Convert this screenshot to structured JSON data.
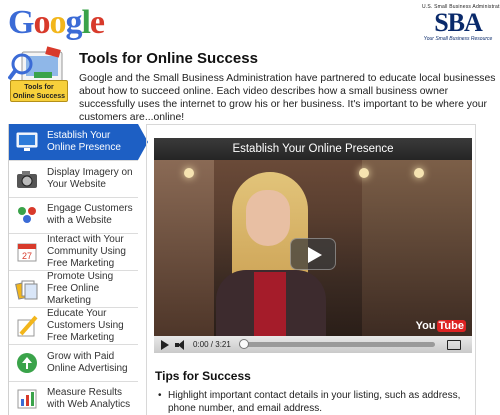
{
  "header": {
    "google_logo_letters": [
      {
        "char": "G",
        "color": "#3b6bd6"
      },
      {
        "char": "o",
        "color": "#d83a2b"
      },
      {
        "char": "o",
        "color": "#f2b61c"
      },
      {
        "char": "g",
        "color": "#3b6bd6"
      },
      {
        "char": "l",
        "color": "#3aa34a"
      },
      {
        "char": "e",
        "color": "#d83a2b"
      }
    ],
    "sba_top": "U.S. Small Business Administration",
    "sba_letters": "SBA",
    "sba_tagline": "Your Small Business Resource"
  },
  "hero": {
    "badge_label_line1": "Tools for",
    "badge_label_line2": "Online Success",
    "title": "Tools for Online Success",
    "intro": "Google and the Small Business Administration have partnered to educate local businesses about how to succeed online. Each video describes how a small business owner successfully uses the internet to grow his or her business. It's important to be where your customers are...online!"
  },
  "sidebar": {
    "items": [
      {
        "label": "Establish Your Online Presence",
        "icon": "monitor-icon",
        "active": true
      },
      {
        "label": "Display Imagery on Your Website",
        "icon": "camera-icon",
        "active": false
      },
      {
        "label": "Engage Customers with a Website",
        "icon": "people-icon",
        "active": false
      },
      {
        "label": "Interact with Your Community Using Free Marketing",
        "icon": "calendar-icon",
        "active": false
      },
      {
        "label": "Promote Using Free Online Marketing",
        "icon": "documents-icon",
        "active": false
      },
      {
        "label": "Educate Your Customers Using Free Marketing",
        "icon": "pencil-icon",
        "active": false
      },
      {
        "label": "Grow with Paid Online Advertising",
        "icon": "growth-icon",
        "active": false
      },
      {
        "label": "Measure Results with Web Analytics",
        "icon": "analytics-icon",
        "active": false
      }
    ]
  },
  "video": {
    "title": "Establish Your Online Presence",
    "time": "0:00 / 3:21",
    "progress": 0,
    "youtube_text_1": "You",
    "youtube_text_2": "Tube"
  },
  "tips": {
    "title": "Tips for Success",
    "items": [
      "Highlight important contact details in your listing, such as address, phone number, and email address."
    ]
  }
}
